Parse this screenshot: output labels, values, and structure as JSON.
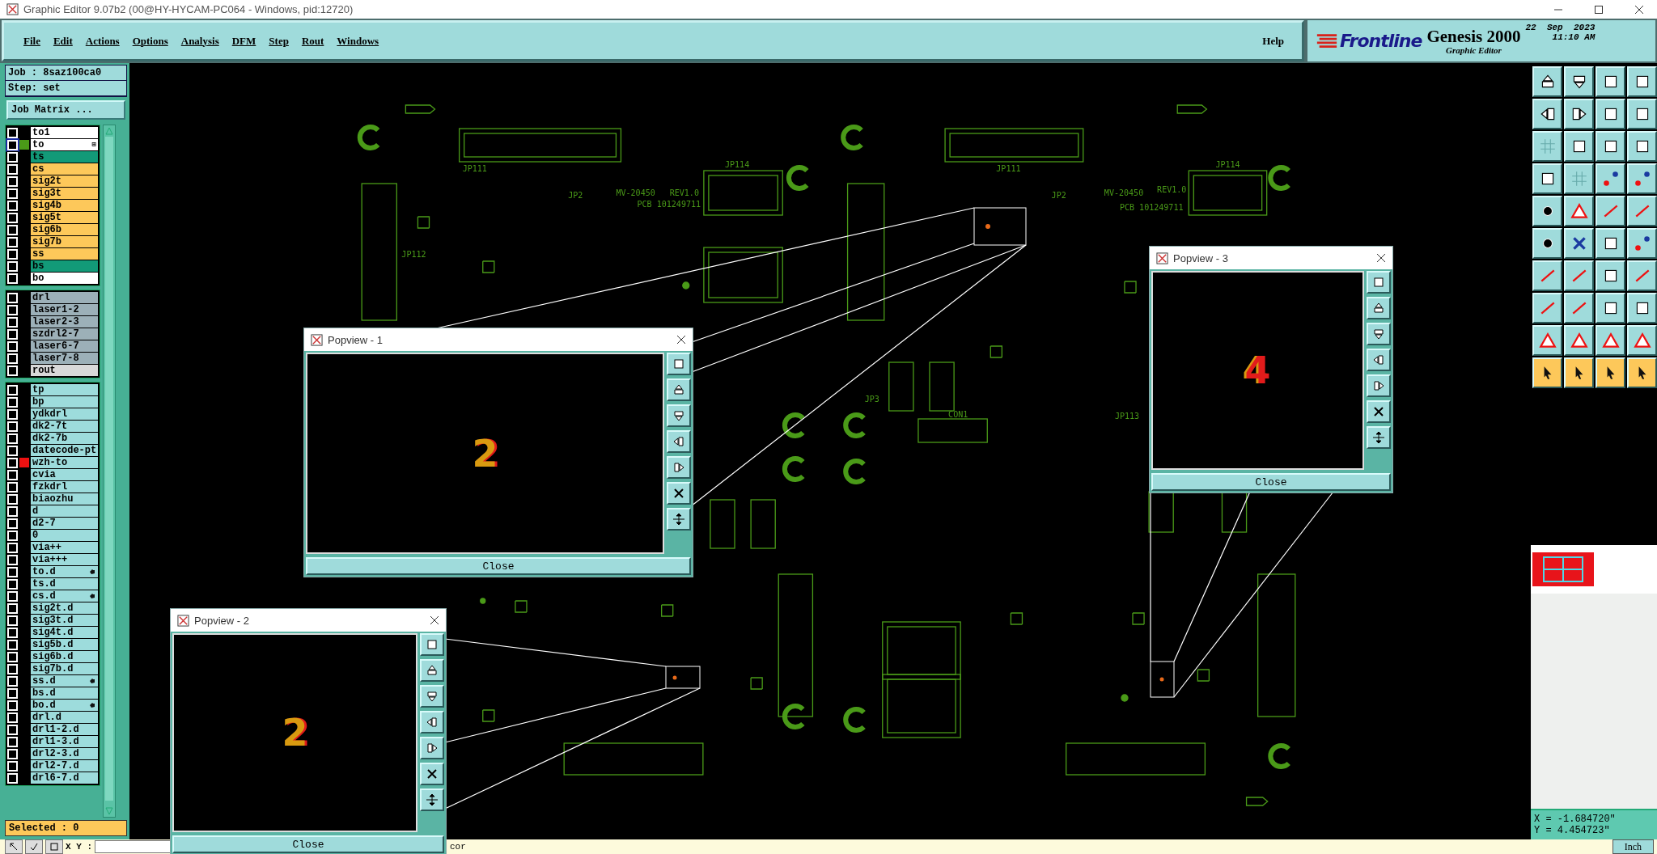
{
  "window": {
    "title": "Graphic Editor 9.07b2 (00@HY-HYCAM-PC064 - Windows, pid:12720)"
  },
  "menu": [
    "File",
    "Edit",
    "Actions",
    "Options",
    "Analysis",
    "DFM",
    "Step",
    "Rout",
    "Windows"
  ],
  "help": "Help",
  "brand": {
    "logo": "Frontline",
    "product": "Genesis 2000",
    "subtitle": "Graphic Editor",
    "date": "22  Sep  2023",
    "time": "11:10 AM"
  },
  "job": {
    "job": "Job : 8saz100ca0",
    "step": "Step: set",
    "matrix_button": "Job Matrix ..."
  },
  "layer_groups": [
    [
      {
        "name": "to1",
        "color": "#ffffff",
        "selected": false
      },
      {
        "name": "to",
        "color": "#ffffff",
        "selected": true,
        "marker": {
          "color": "#4a9a18"
        },
        "symbol": "⊞"
      },
      {
        "name": "ts",
        "color": "#129a78",
        "selected": false
      },
      {
        "name": "cs",
        "color": "#fdc85a",
        "selected": false
      },
      {
        "name": "sig2t",
        "color": "#fdc85a",
        "selected": false
      },
      {
        "name": "sig3t",
        "color": "#fdc85a",
        "selected": false
      },
      {
        "name": "sig4b",
        "color": "#fdc85a",
        "selected": false
      },
      {
        "name": "sig5t",
        "color": "#fdc85a",
        "selected": false
      },
      {
        "name": "sig6b",
        "color": "#fdc85a",
        "selected": false
      },
      {
        "name": "sig7b",
        "color": "#fdc85a",
        "selected": false
      },
      {
        "name": "ss",
        "color": "#fdc85a",
        "selected": false
      },
      {
        "name": "bs",
        "color": "#129a78",
        "selected": false
      },
      {
        "name": "bo",
        "color": "#ffffff",
        "selected": false
      }
    ],
    [
      {
        "name": "drl",
        "color": "#9cb0b8",
        "selected": false
      },
      {
        "name": "laser1-2",
        "color": "#9cb0b8",
        "selected": false
      },
      {
        "name": "laser2-3",
        "color": "#9cb0b8",
        "selected": false
      },
      {
        "name": "szdrl2-7",
        "color": "#9cb0b8",
        "selected": false
      },
      {
        "name": "laser6-7",
        "color": "#9cb0b8",
        "selected": false
      },
      {
        "name": "laser7-8",
        "color": "#9cb0b8",
        "selected": false
      },
      {
        "name": "rout",
        "color": "#d9d9d9",
        "selected": false
      }
    ],
    [
      {
        "name": "tp",
        "color": "#9ddcdc",
        "selected": false
      },
      {
        "name": "bp",
        "color": "#9ddcdc",
        "selected": false
      },
      {
        "name": "ydkdrl",
        "color": "#9ddcdc",
        "selected": false
      },
      {
        "name": "dk2-7t",
        "color": "#9ddcdc",
        "selected": false
      },
      {
        "name": "dk2-7b",
        "color": "#9ddcdc",
        "selected": false
      },
      {
        "name": "datecode-pt",
        "color": "#9ddcdc",
        "selected": false
      },
      {
        "name": "wzh-to",
        "color": "#9ddcdc",
        "selected": false,
        "marker": {
          "color": "#ee1111"
        }
      },
      {
        "name": "cvia",
        "color": "#9ddcdc",
        "selected": false
      },
      {
        "name": "fzkdrl",
        "color": "#9ddcdc",
        "selected": false
      },
      {
        "name": "biaozhu",
        "color": "#9ddcdc",
        "selected": false
      },
      {
        "name": "d",
        "color": "#9ddcdc",
        "selected": false
      },
      {
        "name": "d2-7",
        "color": "#9ddcdc",
        "selected": false
      },
      {
        "name": "0",
        "color": "#9ddcdc",
        "selected": false
      },
      {
        "name": "via++",
        "color": "#9ddcdc",
        "selected": false
      },
      {
        "name": "via+++",
        "color": "#9ddcdc",
        "selected": false
      },
      {
        "name": "to.d",
        "color": "#9ddcdc",
        "selected": false,
        "hand": true
      },
      {
        "name": "ts.d",
        "color": "#9ddcdc",
        "selected": false
      },
      {
        "name": "cs.d",
        "color": "#9ddcdc",
        "selected": false,
        "hand": true
      },
      {
        "name": "sig2t.d",
        "color": "#9ddcdc",
        "selected": false
      },
      {
        "name": "sig3t.d",
        "color": "#9ddcdc",
        "selected": false
      },
      {
        "name": "sig4t.d",
        "color": "#9ddcdc",
        "selected": false
      },
      {
        "name": "sig5b.d",
        "color": "#9ddcdc",
        "selected": false
      },
      {
        "name": "sig6b.d",
        "color": "#9ddcdc",
        "selected": false
      },
      {
        "name": "sig7b.d",
        "color": "#9ddcdc",
        "selected": false
      },
      {
        "name": "ss.d",
        "color": "#9ddcdc",
        "selected": false,
        "hand": true
      },
      {
        "name": "bs.d",
        "color": "#9ddcdc",
        "selected": false
      },
      {
        "name": "bo.d",
        "color": "#9ddcdc",
        "selected": false,
        "hand": true
      },
      {
        "name": "drl.d",
        "color": "#9ddcdc",
        "selected": false
      },
      {
        "name": "drl1-2.d",
        "color": "#9ddcdc",
        "selected": false
      },
      {
        "name": "drl1-3.d",
        "color": "#9ddcdc",
        "selected": false
      },
      {
        "name": "drl2-3.d",
        "color": "#9ddcdc",
        "selected": false
      },
      {
        "name": "drl2-7.d",
        "color": "#9ddcdc",
        "selected": false
      },
      {
        "name": "drl6-7.d",
        "color": "#9ddcdc",
        "selected": false
      }
    ]
  ],
  "selected_count": "Selected : 0",
  "canvas": {
    "labels": [
      "JP111",
      "JP114",
      "JP2",
      "MV-20450",
      "REV1.0",
      "PCB 101249711",
      "JP111",
      "JP114",
      "JP2",
      "MV-20450",
      "REV1.0",
      "PCB 101249711",
      "CON1",
      "JP113",
      "JP112",
      "JP3"
    ]
  },
  "popviews": [
    {
      "title": "Popview - 1",
      "digit": "2",
      "close": "Close"
    },
    {
      "title": "Popview - 2",
      "digit": "2",
      "close": "Close"
    },
    {
      "title": "Popview - 3",
      "digit": "4",
      "close": "Close"
    }
  ],
  "coordinates": {
    "x": "X = -1.684720\"",
    "y": "Y = 4.454723\""
  },
  "bottom_bar": {
    "xy_label": "X Y :",
    "text": "cor",
    "unit": "Inch"
  }
}
